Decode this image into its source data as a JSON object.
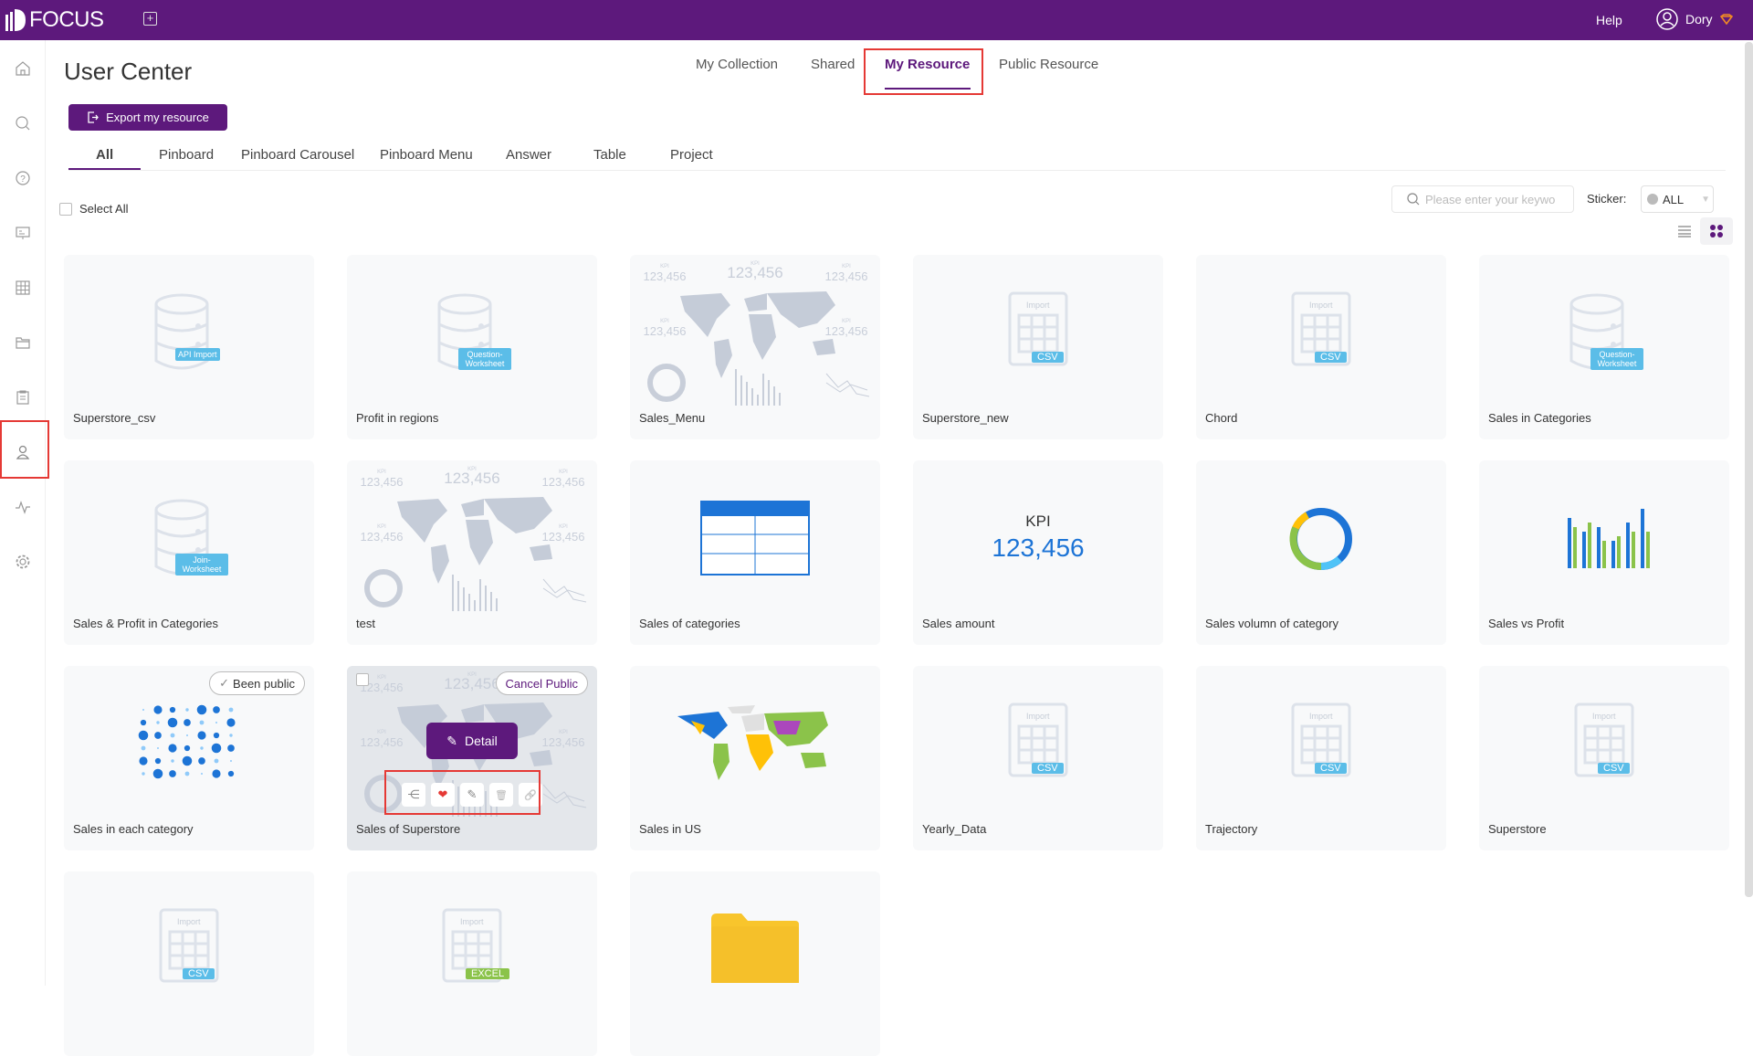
{
  "header": {
    "logo": "FOCUS",
    "help": "Help",
    "user": "Dory",
    "brand_color": "#5d197c"
  },
  "sidebar": {
    "items": [
      {
        "icon": "home-icon"
      },
      {
        "icon": "search-icon"
      },
      {
        "icon": "question-icon"
      },
      {
        "icon": "presentation-icon"
      },
      {
        "icon": "table-icon"
      },
      {
        "icon": "folder-icon"
      },
      {
        "icon": "clipboard-icon"
      },
      {
        "icon": "user-icon",
        "active": true
      },
      {
        "icon": "activity-icon"
      },
      {
        "icon": "gear-icon"
      }
    ]
  },
  "page": {
    "title": "User Center",
    "export_label": "Export my resource"
  },
  "top_tabs": [
    {
      "label": "My Collection"
    },
    {
      "label": "Shared"
    },
    {
      "label": "My Resource",
      "active": true
    },
    {
      "label": "Public Resource"
    }
  ],
  "sub_tabs": [
    {
      "label": "All",
      "active": true
    },
    {
      "label": "Pinboard"
    },
    {
      "label": "Pinboard Carousel"
    },
    {
      "label": "Pinboard Menu"
    },
    {
      "label": "Answer"
    },
    {
      "label": "Table"
    },
    {
      "label": "Project"
    }
  ],
  "toolbar": {
    "select_all": "Select All",
    "search_placeholder": "Please enter your keywo",
    "sticker_label": "Sticker:",
    "sticker_value": "ALL"
  },
  "cards": [
    {
      "name": "Superstore_csv",
      "thumb": "db",
      "badge": "API Import"
    },
    {
      "name": "Profit in regions",
      "thumb": "db",
      "badge": "Question-Worksheet"
    },
    {
      "name": "Sales_Menu",
      "thumb": "dashboard"
    },
    {
      "name": "Superstore_new",
      "thumb": "import",
      "badge": "CSV"
    },
    {
      "name": "Chord",
      "thumb": "import",
      "badge": "CSV"
    },
    {
      "name": "Sales in Categories",
      "thumb": "db",
      "badge": "Question-Worksheet"
    },
    {
      "name": "Sales & Profit in Categories",
      "thumb": "db",
      "badge": "Join-Worksheet"
    },
    {
      "name": "test",
      "thumb": "dashboard"
    },
    {
      "name": "Sales of categories",
      "thumb": "table"
    },
    {
      "name": "Sales amount",
      "thumb": "kpi",
      "kpi_label": "KPI",
      "kpi_value": "123,456"
    },
    {
      "name": "Sales volumn of category",
      "thumb": "donut"
    },
    {
      "name": "Sales vs Profit",
      "thumb": "bars"
    },
    {
      "name": "Sales in each category",
      "thumb": "bubbles",
      "public_label": "Been public"
    },
    {
      "name": "Sales of Superstore",
      "thumb": "dashboard",
      "hover": true,
      "public_label": "Cancel Public",
      "detail_label": "Detail"
    },
    {
      "name": "Sales in US",
      "thumb": "map"
    },
    {
      "name": "Yearly_Data",
      "thumb": "import",
      "badge": "CSV"
    },
    {
      "name": "Trajectory",
      "thumb": "import",
      "badge": "CSV"
    },
    {
      "name": "Superstore",
      "thumb": "import",
      "badge": "CSV"
    },
    {
      "name": "",
      "thumb": "import",
      "badge": "CSV"
    },
    {
      "name": "",
      "thumb": "import",
      "badge": "EXCEL",
      "badge_color": "#8bc34a"
    },
    {
      "name": "",
      "thumb": "folder"
    }
  ],
  "thumb_text": {
    "import": "Import",
    "kpi": "KPI",
    "kpi_value": "123,456"
  }
}
